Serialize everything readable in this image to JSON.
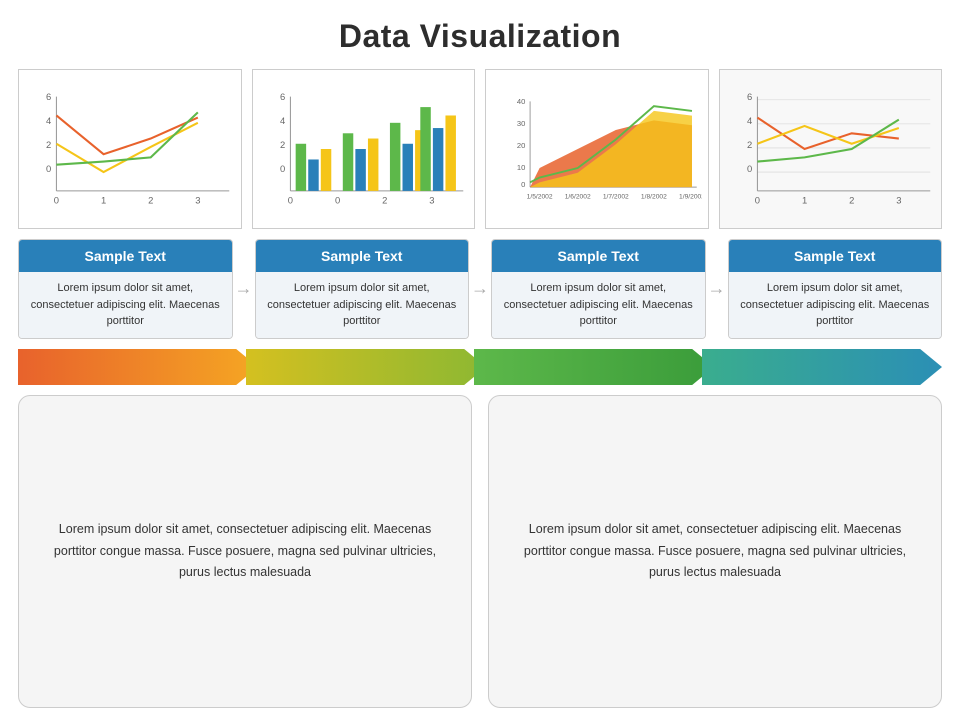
{
  "title": "Data Visualization",
  "charts": [
    {
      "id": "line-chart",
      "type": "line"
    },
    {
      "id": "bar-chart",
      "type": "bar"
    },
    {
      "id": "area-chart",
      "type": "area"
    },
    {
      "id": "line-chart-2",
      "type": "line2"
    }
  ],
  "cards": [
    {
      "header": "Sample Text",
      "body": "Lorem ipsum dolor sit amet, consectetuer adipiscing elit. Maecenas porttitor"
    },
    {
      "header": "Sample Text",
      "body": "Lorem ipsum dolor sit amet, consectetuer adipiscing elit. Maecenas porttitor"
    },
    {
      "header": "Sample Text",
      "body": "Lorem ipsum dolor sit amet, consectetuer adipiscing elit. Maecenas porttitor"
    },
    {
      "header": "Sample Text",
      "body": "Lorem ipsum dolor sit amet, consectetuer adipiscing elit. Maecenas porttitor"
    }
  ],
  "arrows": [
    {
      "color1": "#e8622c",
      "color2": "#f5a623"
    },
    {
      "color1": "#d4c020",
      "color2": "#8db832"
    },
    {
      "color1": "#5db84a",
      "color2": "#3a9c3a"
    },
    {
      "color1": "#3aad8e",
      "color2": "#2b8fb5"
    }
  ],
  "text_boxes": [
    {
      "text": "Lorem ipsum dolor sit amet, consectetuer adipiscing elit. Maecenas porttitor congue massa. Fusce posuere, magna sed pulvinar ultricies, purus lectus malesuada"
    },
    {
      "text": "Lorem ipsum dolor sit amet, consectetuer adipiscing elit. Maecenas porttitor congue massa. Fusce posuere, magna sed pulvinar ultricies, purus lectus malesuada"
    }
  ],
  "connector_arrow": "→"
}
